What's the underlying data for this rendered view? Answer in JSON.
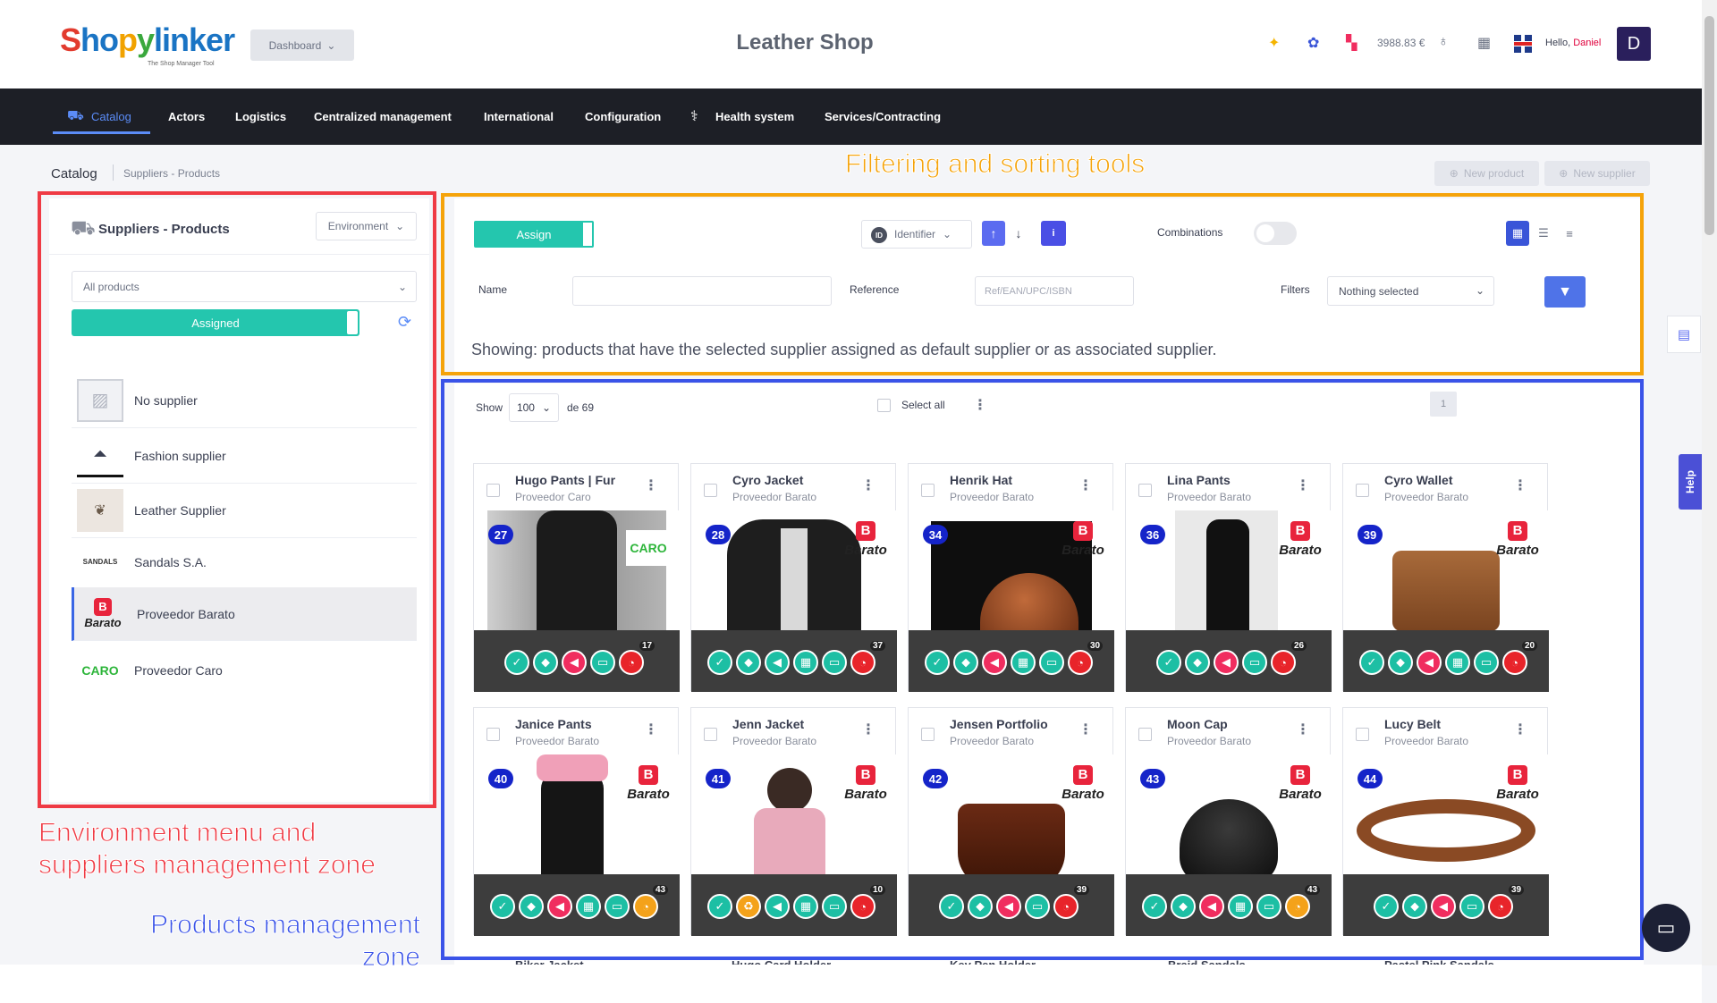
{
  "header": {
    "logo_text": "Shopylinker",
    "logo_tagline": "The Shop Manager Tool",
    "dashboard_label": "Dashboard",
    "shop_title": "Leather Shop",
    "balance": "3988.83 €",
    "hello": "Hello,",
    "user_name": "Daniel",
    "avatar_letter": "D"
  },
  "nav": {
    "items": [
      {
        "label": "Catalog",
        "active": true
      },
      {
        "label": "Actors"
      },
      {
        "label": "Logistics"
      },
      {
        "label": "Centralized management"
      },
      {
        "label": "International"
      },
      {
        "label": "Configuration"
      },
      {
        "label": "Health system"
      },
      {
        "label": "Services/Contracting"
      }
    ]
  },
  "breadcrumb": {
    "root": "Catalog",
    "current": "Suppliers - Products",
    "new_product": "New product",
    "new_supplier": "New supplier"
  },
  "left_panel": {
    "title": "Suppliers - Products",
    "environment_label": "Environment",
    "products_filter": "All products",
    "assigned_label": "Assigned",
    "suppliers": [
      {
        "name": "No supplier",
        "logo": "placeholder-image-icon"
      },
      {
        "name": "Fashion supplier",
        "logo": "hanger-icon"
      },
      {
        "name": "Leather Supplier",
        "logo": "leather-supplier-logo"
      },
      {
        "name": "Sandals S.A.",
        "logo": "sandals-logo"
      },
      {
        "name": "Proveedor Barato",
        "logo": "barato-logo",
        "selected": true
      },
      {
        "name": "Proveedor Caro",
        "logo": "caro-logo"
      }
    ],
    "barato_text": "Barato",
    "caro_text": "CARO",
    "sandals_text": "SANDALS"
  },
  "tools": {
    "assign_label": "Assign",
    "identifier_label": "Identifier",
    "id_badge": "ID",
    "combinations_label": "Combinations",
    "name_label": "Name",
    "name_value": "",
    "reference_label": "Reference",
    "reference_placeholder": "Ref/EAN/UPC/ISBN",
    "filters_label": "Filters",
    "filters_value": "Nothing selected",
    "showing_text": "Showing: products that have the selected supplier assigned as default supplier or as associated supplier."
  },
  "products_panel": {
    "show_label": "Show",
    "page_size": "100",
    "of_label": "de 69",
    "select_all_label": "Select all",
    "page_number": "1",
    "products": [
      {
        "id": "27",
        "name": "Hugo Pants | Fur",
        "supplier": "Proveedor Caro",
        "count": "17",
        "logo": "caro"
      },
      {
        "id": "28",
        "name": "Cyro Jacket",
        "supplier": "Proveedor Barato",
        "count": "37",
        "logo": "barato"
      },
      {
        "id": "34",
        "name": "Henrik Hat",
        "supplier": "Proveedor Barato",
        "count": "30",
        "logo": "barato"
      },
      {
        "id": "36",
        "name": "Lina Pants",
        "supplier": "Proveedor Barato",
        "count": "26",
        "logo": "barato"
      },
      {
        "id": "39",
        "name": "Cyro Wallet",
        "supplier": "Proveedor Barato",
        "count": "20",
        "logo": "barato"
      },
      {
        "id": "40",
        "name": "Janice Pants",
        "supplier": "Proveedor Barato",
        "count": "43",
        "logo": "barato"
      },
      {
        "id": "41",
        "name": "Jenn Jacket",
        "supplier": "Proveedor Barato",
        "count": "10",
        "logo": "barato"
      },
      {
        "id": "42",
        "name": "Jensen Portfolio",
        "supplier": "Proveedor Barato",
        "count": "39",
        "logo": "barato"
      },
      {
        "id": "43",
        "name": "Moon Cap",
        "supplier": "Proveedor Barato",
        "count": "43",
        "logo": "barato"
      },
      {
        "id": "44",
        "name": "Lucy Belt",
        "supplier": "Proveedor Barato",
        "count": "39",
        "logo": "barato"
      }
    ],
    "next_row_names": [
      "Biker Jacket",
      "Hugo Card Holder",
      "Key Pen Holder",
      "Braid Sandals",
      "Pastel Pink Sandals"
    ]
  },
  "annotations": {
    "filtering": "Filtering and sorting tools",
    "environment": "Environment menu and suppliers management zone",
    "environment_line1": "Environment menu and",
    "environment_line2": "suppliers management zone",
    "products": "Products management zone",
    "products_line1": "Products management",
    "products_line2": "zone"
  },
  "side": {
    "help_label": "Help"
  },
  "colors": {
    "accent_teal": "#24c6ae",
    "accent_blue": "#4f73e8",
    "nav_bg": "#1d1f26",
    "frame_red": "#ef3a44",
    "frame_yellow": "#f5a30a",
    "frame_blue": "#3a53e8"
  }
}
